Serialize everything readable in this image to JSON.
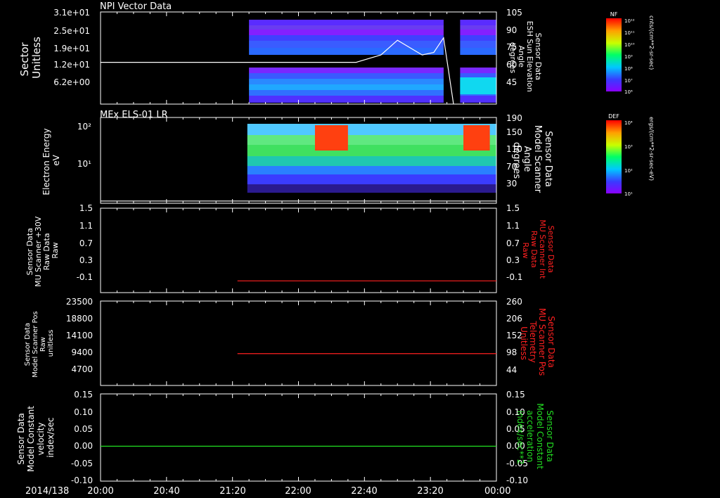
{
  "date_label": "2014/138",
  "time_ticks": [
    "20:00",
    "20:40",
    "21:20",
    "22:00",
    "22:40",
    "23:20",
    "00:00"
  ],
  "colors": {
    "background": "#000000",
    "axis": "#ffffff",
    "red": "#ff2020",
    "green": "#22dd22"
  },
  "chart_data": [
    {
      "type": "heatmap",
      "title": "NPI Vector Data",
      "ylabel": [
        "Sector",
        "Unitless"
      ],
      "yticks": [
        "3.1e+01",
        "2.5e+01",
        "1.9e+01",
        "1.2e+01",
        "6.2e+00"
      ],
      "right_ylabel": [
        "Sensor Data",
        "ESH Sun Elevation",
        "Angle",
        "degrees"
      ],
      "right_yticks": [
        "105",
        "90",
        "75",
        "60",
        "45"
      ],
      "right_ylim": [
        30,
        105
      ],
      "data_start": "21:30",
      "data_gap": [
        "23:28",
        "23:38"
      ],
      "colorbar": {
        "label": "NF",
        "unit": "cnts/(cm**2-sr-sec)",
        "ticks": [
          "10¹²",
          "10¹¹",
          "10¹⁰",
          "10⁹",
          "10⁸",
          "10⁷",
          "10⁶"
        ]
      },
      "series": [
        {
          "x": [
            "20:00",
            "22:35",
            "22:50",
            "23:00",
            "23:15",
            "23:22",
            "23:28",
            "23:34"
          ],
          "y": [
            64,
            64,
            70,
            82,
            70,
            72,
            84,
            30
          ]
        }
      ]
    },
    {
      "type": "heatmap",
      "title": "MEx ELS-01 LR",
      "ylabel": [
        "Electron Energy",
        "eV"
      ],
      "yticks": [
        "10²",
        "10¹"
      ],
      "ylim_log": [
        0.3,
        2.2
      ],
      "right_ylabel": [
        "Sensor Data",
        "Model Scanner",
        "Angle",
        "degrees"
      ],
      "right_yticks": [
        "190",
        "150",
        "110",
        "70",
        "30"
      ],
      "right_ylim": [
        0,
        190
      ],
      "data_start": "21:29",
      "bursts": [
        [
          "22:10",
          "22:30"
        ],
        [
          "23:40",
          "23:56"
        ]
      ],
      "colorbar": {
        "label": "DEF",
        "unit": "ergs/(cm**2-sr-sec-eV)",
        "ticks": [
          "10⁴",
          "10³",
          "10²",
          "10¹"
        ]
      },
      "series": [
        {
          "x": [
            "20:00",
            "00:00"
          ],
          "y": [
            5,
            5
          ]
        }
      ]
    },
    {
      "type": "line",
      "ylabel": [
        "Sensor Data",
        "MU Scanner +30V",
        "Raw Data",
        "Raw"
      ],
      "yticks": [
        "1.5",
        "1.1",
        "0.7",
        "0.3",
        "-0.1"
      ],
      "ylim": [
        -0.3,
        1.5
      ],
      "right_ylabel": [
        "Sensor Data",
        "MU Scanner Int",
        "Raw Data",
        "Raw"
      ],
      "right_yticks": [
        "1.5",
        "1.1",
        "0.7",
        "0.3",
        "-0.1"
      ],
      "series": [
        {
          "x": [
            "21:23",
            "00:00"
          ],
          "y": [
            -0.05,
            -0.05
          ]
        }
      ]
    },
    {
      "type": "line",
      "ylabel": [
        "Sensor Data",
        "Model Scanner Pos",
        "Raw",
        "unitless"
      ],
      "yticks": [
        "23500",
        "18800",
        "14100",
        "9400",
        "4700"
      ],
      "ylim": [
        0,
        23500
      ],
      "right_ylabel": [
        "Sensor Data",
        "MU Scanner Pos",
        "Telemetry",
        "Unitless"
      ],
      "right_yticks": [
        "260",
        "206",
        "152",
        "98",
        "44"
      ],
      "right_ylim": [
        0,
        260
      ],
      "series": [
        {
          "x": [
            "21:23",
            "00:00"
          ],
          "y": [
            98,
            98
          ]
        }
      ]
    },
    {
      "type": "line",
      "ylabel": [
        "Sensor Data",
        "Model Constant",
        "velocity",
        "index/sec"
      ],
      "yticks": [
        "0.15",
        "0.10",
        "0.05",
        "0.00",
        "-0.05",
        "-0.10"
      ],
      "ylim": [
        -0.1,
        0.15
      ],
      "right_ylabel": [
        "Sensor Data",
        "Model Constant",
        "acceleration",
        "index/sec**2"
      ],
      "right_yticks": [
        "0.15",
        "0.10",
        "0.05",
        "0.00",
        "-0.05",
        "-0.10"
      ],
      "series": [
        {
          "x": [
            "20:00",
            "00:00"
          ],
          "y": [
            0,
            0
          ]
        }
      ]
    }
  ]
}
